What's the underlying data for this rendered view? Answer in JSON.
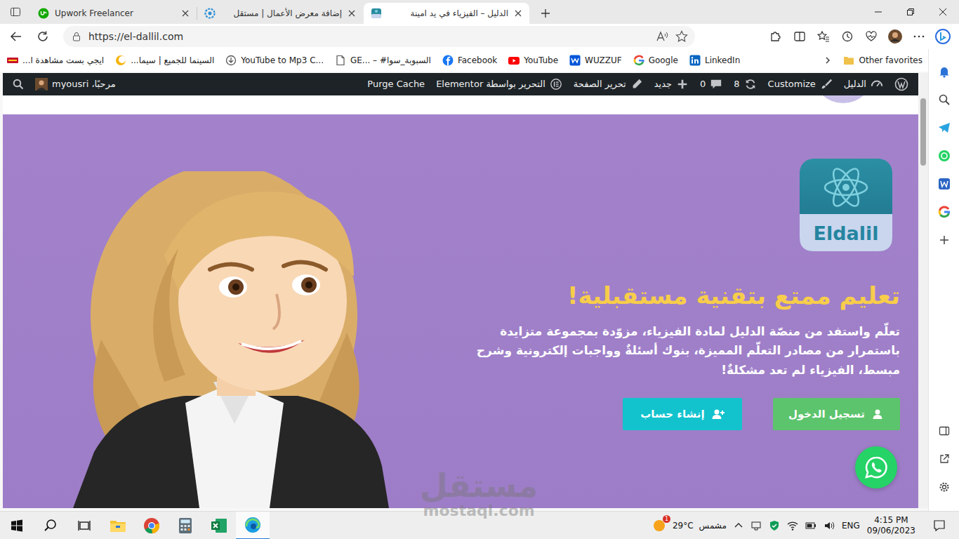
{
  "tabs": [
    {
      "label": "Upwork Freelancer",
      "kind": "upwork",
      "selected": false
    },
    {
      "label": "إضافة معرض الأعمال | مستقل",
      "kind": "mostaql",
      "selected": false
    },
    {
      "label": "الدليل – الفيزياء في يد امينة",
      "kind": "eldalil",
      "selected": true
    }
  ],
  "address_bar": {
    "url": "https://el-dallil.com"
  },
  "bookmarks": [
    {
      "label": "ايجي بست مشاهدة ا...",
      "kind": "egybest"
    },
    {
      "label": "السينما للجميع | سيما...",
      "kind": "cinema"
    },
    {
      "label": "YouTube to Mp3 C...",
      "kind": "download"
    },
    {
      "label": "GE... – #السبوبة_سوا",
      "kind": "page"
    },
    {
      "label": "Facebook",
      "kind": "facebook"
    },
    {
      "label": "YouTube",
      "kind": "youtube"
    },
    {
      "label": "WUZZUF",
      "kind": "wuzzuf"
    },
    {
      "label": "Google",
      "kind": "google"
    },
    {
      "label": "LinkedIn",
      "kind": "linkedin"
    }
  ],
  "other_favorites": "Other favorites",
  "admin_bar": {
    "items": [
      {
        "label": "الدليل",
        "kind": "dashboard"
      },
      {
        "label": "Customize",
        "kind": "customize"
      },
      {
        "label": "8",
        "kind": "updates"
      },
      {
        "label": "0",
        "kind": "comments"
      },
      {
        "label": "جديد",
        "kind": "new"
      },
      {
        "label": "تحرير الصفحة",
        "kind": "edit"
      },
      {
        "label": "التحرير بواسطة Elementor",
        "kind": "elementor"
      },
      {
        "label": "Purge Cache",
        "kind": "plain"
      }
    ],
    "greeting": "مرحبًا، myousri"
  },
  "hero": {
    "logo_text": "Eldalil",
    "title": "تعليم ممتع بتقنية مستقبلية!",
    "text": "تعلّم واستفد من منصّة الدليل لمادة الفيزياء، مزوّدة بمجموعة متزايدة باستمرار من مصادر التعلّم المميزة، بنوك أسئلةٌ وواجبات إلكترونية وشرح مبسط، الفيزياء لم تعد مشكلةٌ!",
    "buttons": [
      {
        "label": "تسجيل الدخول",
        "kind": "login",
        "color": "#5cc46d"
      },
      {
        "label": "إنشاء حساب",
        "kind": "register",
        "color": "#12c3ce"
      }
    ]
  },
  "watermark": {
    "word": "مستقل",
    "site": "mostaql.com"
  },
  "taskbar": {
    "weather_badge": "1",
    "temperature": "29°C",
    "weather": "مشمس",
    "language": "ENG",
    "time": "4:15 PM",
    "date": "09/06/2023"
  }
}
